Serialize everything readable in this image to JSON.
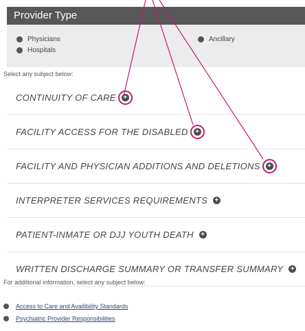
{
  "panel": {
    "title": "Provider Type",
    "radios": [
      {
        "label": "Physicians"
      },
      {
        "label": "Ancillary"
      },
      {
        "label": "Hospitals"
      }
    ],
    "select_prompt": "Select any subject below:"
  },
  "subjects": [
    {
      "label": "CONTINUITY OF CARE",
      "highlighted": true
    },
    {
      "label": "FACILITY ACCESS FOR THE DISABLED",
      "highlighted": true
    },
    {
      "label": "FACILITY AND PHYSICIAN ADDITIONS AND DELETIONS",
      "highlighted": true
    },
    {
      "label": "INTERPRETER SERVICES REQUIREMENTS",
      "highlighted": false
    },
    {
      "label": "PATIENT-INMATE OR DJJ YOUTH DEATH",
      "highlighted": false
    },
    {
      "label": "WRITTEN DISCHARGE SUMMARY OR TRANSFER SUMMARY",
      "highlighted": false
    }
  ],
  "additional": {
    "prompt": "For additional information, select any subject below:",
    "links": [
      {
        "label": "Access to Care and Availibility Standards"
      },
      {
        "label": "Psychiatric Provider Responsibilities"
      }
    ]
  },
  "colors": {
    "header_bg": "#575757",
    "radio_bg": "#ececec",
    "callout": "#c0187a",
    "plus_icon": "#4a4a4a"
  },
  "icons": {
    "expand": "plus-circle-icon",
    "radio": "radio-dot-icon"
  }
}
